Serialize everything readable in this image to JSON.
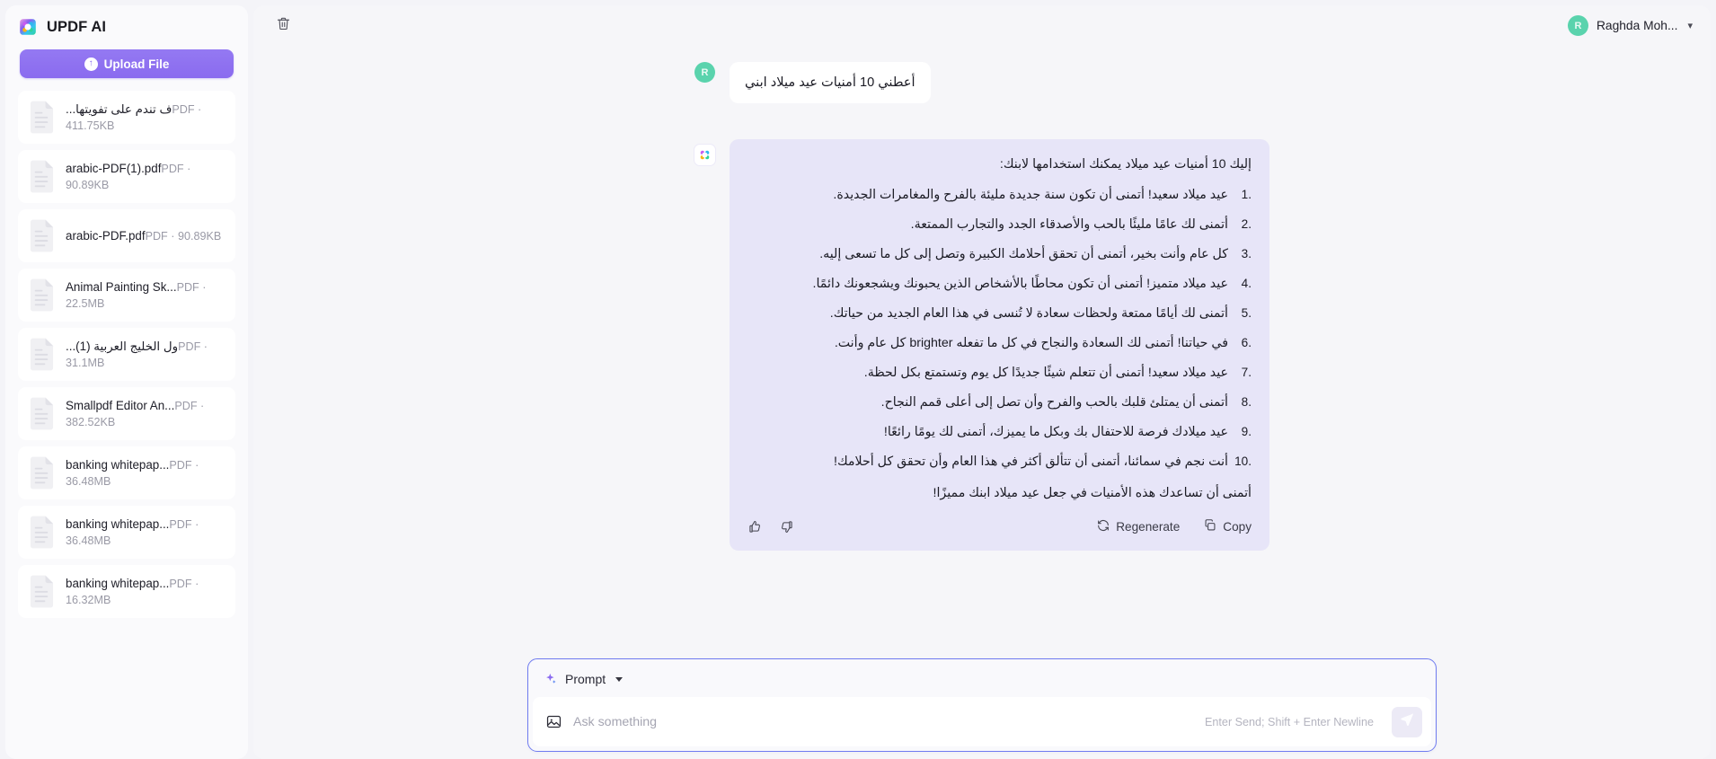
{
  "sidebar": {
    "brand": {
      "title": "UPDF AI",
      "logo_icon": "updf-logo-icon"
    },
    "upload_button": {
      "label": "Upload File",
      "icon": "upload-arrow-icon"
    },
    "files": [
      {
        "name": "...ف تندم على تفويتها",
        "meta": "PDF · 411.75KB"
      },
      {
        "name": "arabic-PDF(1).pdf",
        "meta": "PDF · 90.89KB"
      },
      {
        "name": "arabic-PDF.pdf",
        "meta": "PDF · 90.89KB"
      },
      {
        "name": "Animal Painting Sk...",
        "meta": "PDF · 22.5MB"
      },
      {
        "name": "...ول الخليج العربية (1)",
        "meta": "PDF · 31.1MB"
      },
      {
        "name": "Smallpdf Editor An...",
        "meta": "PDF · 382.52KB"
      },
      {
        "name": "banking whitepap...",
        "meta": "PDF · 36.48MB"
      },
      {
        "name": "banking whitepap...",
        "meta": "PDF · 36.48MB"
      },
      {
        "name": "banking whitepap...",
        "meta": "PDF · 16.32MB"
      }
    ]
  },
  "topbar": {
    "delete_icon": "trash-icon",
    "user": {
      "initial": "R",
      "name": "Raghda Moh...",
      "chevron": "chevron-down-icon"
    }
  },
  "conversation": {
    "user_message": {
      "avatar_initial": "R",
      "text": "أعطني 10 أمنيات عيد ميلاد ابني"
    },
    "ai_message": {
      "avatar_icon": "updf-ai-icon",
      "intro": "إليك 10 أمنيات عيد ميلاد يمكنك استخدامها لابنك:",
      "wishes": [
        "عيد ميلاد سعيد! أتمنى أن تكون سنة جديدة مليئة بالفرح والمغامرات الجديدة.",
        "أتمنى لك عامًا مليئًا بالحب والأصدقاء الجدد والتجارب الممتعة.",
        "كل عام وأنت بخير، أتمنى أن تحقق أحلامك الكبيرة وتصل إلى كل ما تسعى إليه.",
        "عيد ميلاد متميز! أتمنى أن تكون محاطًا بالأشخاص الذين يحبونك ويشجعونك دائمًا.",
        "أتمنى لك أيامًا ممتعة ولحظات سعادة لا تُنسى في هذا العام الجديد من حياتك.",
        "في حياتنا! أتمنى لك السعادة والنجاح في كل ما تفعله brighter كل عام وأنت.",
        "عيد ميلاد سعيد! أتمنى أن تتعلم شيئًا جديدًا كل يوم وتستمتع بكل لحظة.",
        "أتمنى أن يمتلئ قلبك بالحب والفرح وأن تصل إلى أعلى قمم النجاح.",
        "عيد ميلادك فرصة للاحتفال بك وبكل ما يميزك، أتمنى لك يومًا رائعًا!",
        "أنت نجم في سمائنا، أتمنى أن تتألق أكثر في هذا العام وأن تحقق كل أحلامك!"
      ],
      "outro": "أتمنى أن تساعدك هذه الأمنيات في جعل عيد ميلاد ابنك مميزًا!",
      "actions": {
        "like_icon": "thumbs-up-icon",
        "dislike_icon": "thumbs-down-icon",
        "regenerate": {
          "label": "Regenerate",
          "icon": "refresh-icon"
        },
        "copy": {
          "label": "Copy",
          "icon": "copy-icon"
        }
      }
    }
  },
  "prompt": {
    "mode_label": "Prompt",
    "mode_icon": "sparkle-icon",
    "caret_icon": "chevron-down-icon",
    "attach_icon": "image-icon",
    "input_value": "",
    "input_placeholder": "Ask something",
    "hint": "Enter Send; Shift + Enter Newline",
    "send_icon": "send-icon"
  },
  "colors": {
    "accent_purple": "#8b6cf0",
    "ai_bubble": "#e7e5f8",
    "focus_border": "#6f7bf0",
    "avatar_green": "#5ad3ad"
  }
}
